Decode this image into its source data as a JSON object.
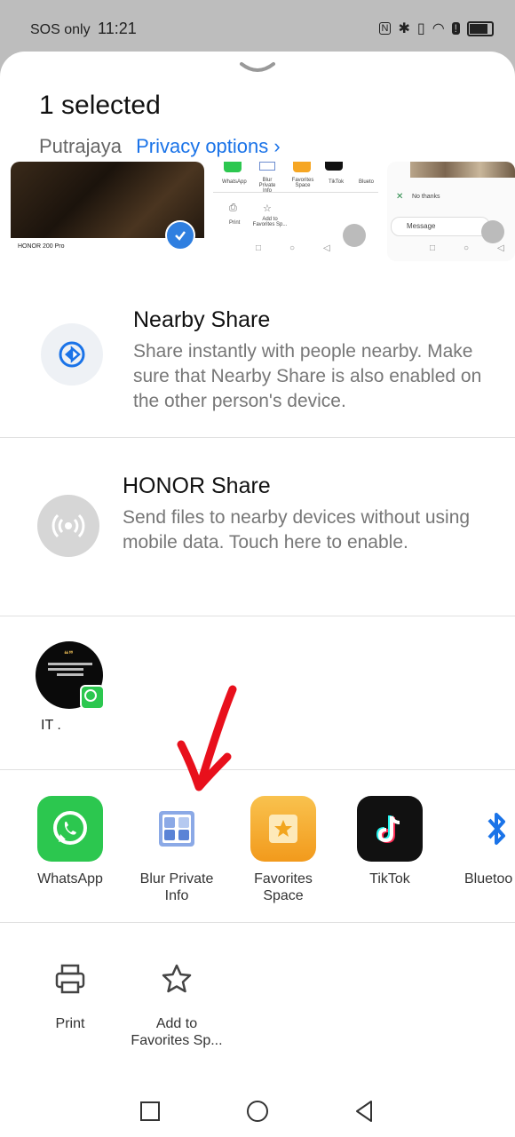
{
  "status_bar": {
    "carrier": "SOS only",
    "time": "11:21"
  },
  "sheet": {
    "title": "1 selected",
    "location": "Putrajaya",
    "privacy_link": "Privacy options",
    "privacy_chevron": "›"
  },
  "thumbnails": {
    "thumb1_caption": "HONOR 200 Pro",
    "thumb2_labels": [
      "WhatsApp",
      "Blur Private Info",
      "Favorites Space",
      "TikTok",
      "Blueto",
      "Print",
      "Add to Favorites Sp..."
    ],
    "thumb3_labels": [
      "No thanks",
      "Message"
    ]
  },
  "nearby_share": {
    "title": "Nearby Share",
    "description": "Share instantly with people nearby. Make sure that Nearby Share is also enabled on the other person's device."
  },
  "honor_share": {
    "title": "HONOR Share",
    "description": "Send files to nearby devices without using mobile data. Touch here to enable."
  },
  "contact": {
    "name": "IT ."
  },
  "apps": [
    {
      "label": "WhatsApp",
      "icon": "whatsapp-icon"
    },
    {
      "label": "Blur Private Info",
      "icon": "blur-private-info-icon"
    },
    {
      "label": "Favorites Space",
      "icon": "favorites-space-icon"
    },
    {
      "label": "TikTok",
      "icon": "tiktok-icon"
    },
    {
      "label": "Bluetoo",
      "icon": "bluetooth-icon"
    }
  ],
  "actions": [
    {
      "label": "Print",
      "icon": "printer-icon"
    },
    {
      "label": "Add to Favorites Sp...",
      "icon": "star-icon"
    }
  ],
  "colors": {
    "accent_blue": "#1a73e8",
    "annotation_red": "#e8101c",
    "whatsapp_green": "#2cc74f"
  }
}
